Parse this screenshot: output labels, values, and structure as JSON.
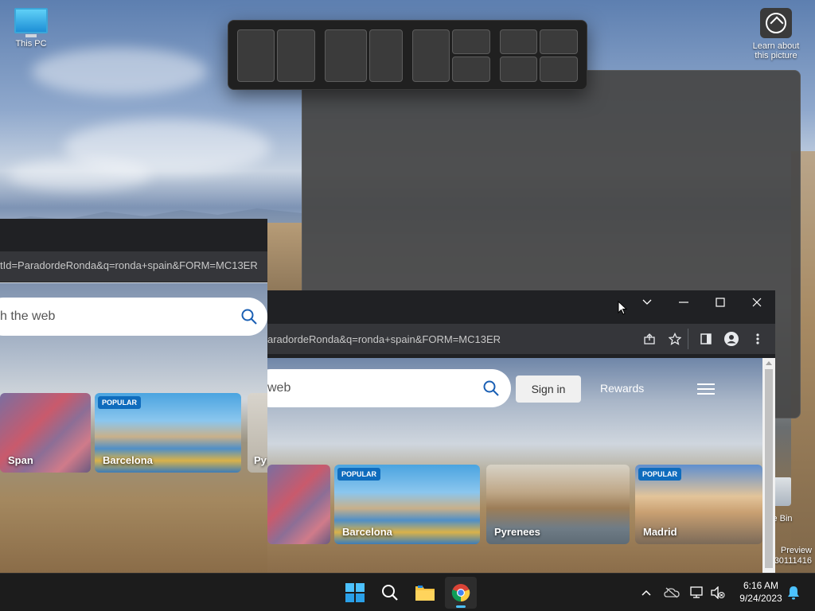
{
  "desktop": {
    "icons": {
      "this_pc": "This PC",
      "learn_line1": "Learn about",
      "learn_line2": "this picture",
      "recycle_partial": "le Bin",
      "preview_line1": "Preview",
      "preview_line2": "30111416"
    }
  },
  "left_window": {
    "url": "tId=ParadordeRonda&q=ronda+spain&FORM=MC13ER",
    "search_placeholder": "h the web",
    "tiles": [
      {
        "label": "Span",
        "badge": ""
      },
      {
        "label": "Barcelona",
        "badge": "POPULAR"
      },
      {
        "label": "Pyr",
        "badge": ""
      }
    ]
  },
  "main_window": {
    "url": "aradordeRonda&q=ronda+spain&FORM=MC13ER",
    "search_placeholder": "web",
    "sign_in": "Sign in",
    "rewards": "Rewards",
    "tiles": [
      {
        "label": "",
        "badge": ""
      },
      {
        "label": "Barcelona",
        "badge": "POPULAR"
      },
      {
        "label": "Pyrenees",
        "badge": ""
      },
      {
        "label": "Madrid",
        "badge": "POPULAR"
      }
    ]
  },
  "taskbar": {
    "time": "6:16 AM",
    "date": "9/24/2023"
  },
  "colors": {
    "taskbar_bg": "#1c1c1c",
    "accent": "#4cc2ff",
    "badge": "#0f6cbd"
  }
}
